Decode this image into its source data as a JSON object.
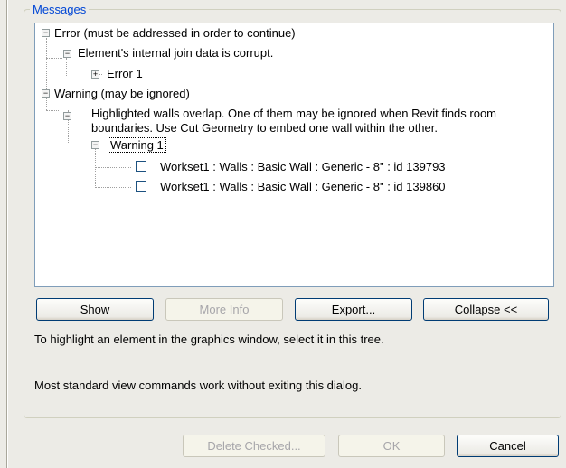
{
  "dialog": {
    "group_title": "Messages",
    "tree": {
      "error_root": "Error (must be addressed in order to continue)",
      "error_child": "Element's internal join data is corrupt.",
      "error_item": "Error 1",
      "warning_root": "Warning (may be ignored)",
      "warning_child_line1": "Highlighted walls overlap. One of them may be ignored when Revit finds room",
      "warning_child_line2": "boundaries. Use Cut Geometry to embed one wall within the other.",
      "warning_item": "Warning 1",
      "elements": [
        "Workset1 : Walls : Basic Wall : Generic - 8\" : id 139793",
        "Workset1 : Walls : Basic Wall : Generic - 8\" : id 139860"
      ]
    },
    "buttons": {
      "show": "Show",
      "more_info": "More Info",
      "export": "Export...",
      "collapse": "Collapse <<",
      "delete_checked": "Delete Checked...",
      "ok": "OK",
      "cancel": "Cancel"
    },
    "hint_highlight": "To highlight an element in the graphics window, select it in this tree.",
    "hint_view": "Most standard view commands work without exiting this dialog."
  }
}
